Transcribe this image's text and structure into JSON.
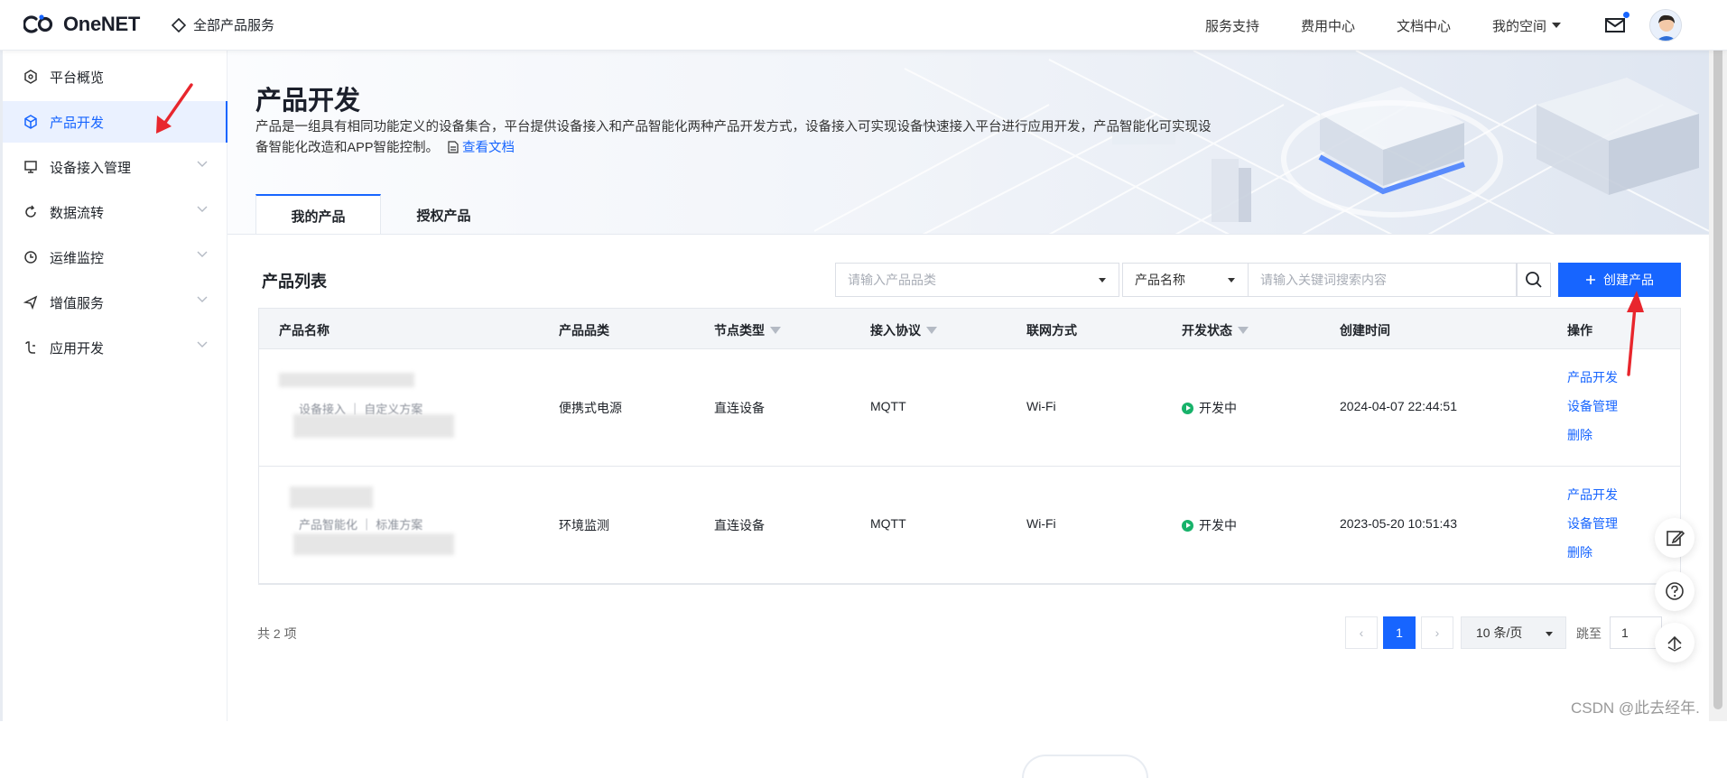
{
  "brand": {
    "name": "OneNET"
  },
  "topbar": {
    "all_services": "全部产品服务",
    "nav": [
      "服务支持",
      "费用中心",
      "文档中心"
    ],
    "my_space": "我的空间"
  },
  "sidebar": {
    "items": [
      {
        "label": "平台概览"
      },
      {
        "label": "产品开发"
      },
      {
        "label": "设备接入管理"
      },
      {
        "label": "数据流转"
      },
      {
        "label": "运维监控"
      },
      {
        "label": "增值服务"
      },
      {
        "label": "应用开发"
      }
    ]
  },
  "page": {
    "title": "产品开发",
    "desc_1": "产品是一组具有相同功能定义的设备集合，平台提供设备接入和产品智能化两种产品开发方式，设备接入可实现设备快速接入平台进行应用开发，产品智能化可实现设",
    "desc_2": "备智能化改造和APP智能控制。",
    "doc_link": "查看文档",
    "tabs": [
      "我的产品",
      "授权产品"
    ]
  },
  "list": {
    "title": "产品列表",
    "category_placeholder": "请输入产品品类",
    "field_select": "产品名称",
    "keyword_placeholder": "请输入关键词搜索内容",
    "create_label": "创建产品",
    "columns": [
      "产品名称",
      "产品品类",
      "节点类型",
      "接入协议",
      "联网方式",
      "开发状态",
      "创建时间",
      "操作"
    ],
    "rows": [
      {
        "name": "",
        "sub": "设备接入 ｜ 自定义方案",
        "category": "便携式电源",
        "node": "直连设备",
        "protocol": "MQTT",
        "network": "Wi-Fi",
        "status": "开发中",
        "created": "2024-04-07 22:44:51",
        "actions": [
          "产品开发",
          "设备管理",
          "删除"
        ]
      },
      {
        "name": "",
        "sub": "产品智能化 ｜ 标准方案",
        "category": "环境监测",
        "node": "直连设备",
        "protocol": "MQTT",
        "network": "Wi-Fi",
        "status": "开发中",
        "created": "2023-05-20 10:51:43",
        "actions": [
          "产品开发",
          "设备管理",
          "删除"
        ]
      }
    ]
  },
  "pagination": {
    "total": "共 2 项",
    "prev": "‹",
    "current": "1",
    "next": "›",
    "page_size": "10 条/页",
    "jump_label": "跳至",
    "jump_value": "1"
  },
  "watermark": "CSDN @此去经年.",
  "colors": {
    "accent": "#1765ff",
    "status_green": "#17b26a",
    "annotation_red": "#e8262d"
  }
}
